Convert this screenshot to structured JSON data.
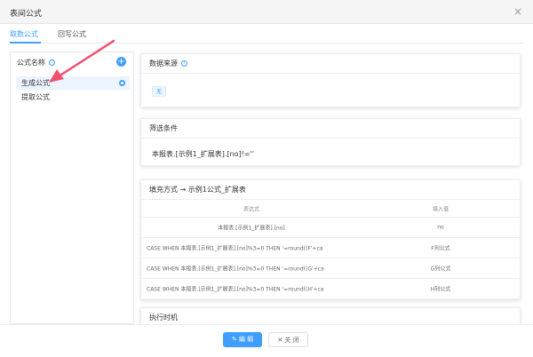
{
  "dialog": {
    "title": "表间公式",
    "close_icon": "×"
  },
  "tabs": [
    {
      "label": "取数公式",
      "active": true
    },
    {
      "label": "回写公式",
      "active": false
    }
  ],
  "formula_list": {
    "header": "公式名称",
    "info_icon": "i",
    "add_icon": "+",
    "items": [
      {
        "label": "生成公式",
        "selected": true
      },
      {
        "label": "提取公式",
        "selected": false
      }
    ]
  },
  "data_source": {
    "title": "数据来源",
    "info_icon": "i",
    "tag": "无"
  },
  "filter": {
    "title": "筛选条件",
    "condition": "本报表.[示例1_扩展表].[no]!=''"
  },
  "fill": {
    "title": "填充方式 → 示例1公式_扩展表",
    "columns": [
      "表达式",
      "填入值"
    ],
    "rows": [
      {
        "expression": "本报表.[示例1_扩展表].[no]",
        "value": "no"
      },
      {
        "expression": "CASE WHEN 本报表.[示例1_扩展表].[no]%3=0 THEN '=round((F'+ca",
        "value": "F列公式"
      },
      {
        "expression": "CASE WHEN 本报表.[示例1_扩展表].[no]%3=0 THEN '=round((G'+ca",
        "value": "G列公式"
      },
      {
        "expression": "CASE WHEN 本报表.[示例1_扩展表].[no]%3=0 THEN '=round((H'+ca",
        "value": "H列公式"
      }
    ]
  },
  "exec_time": {
    "title": "执行时机"
  },
  "footer": {
    "edit_label": "✎ 编 辑",
    "close_label": "✕ 关 闭"
  },
  "colors": {
    "accent": "#409eff",
    "arrow": "#f0506e"
  }
}
